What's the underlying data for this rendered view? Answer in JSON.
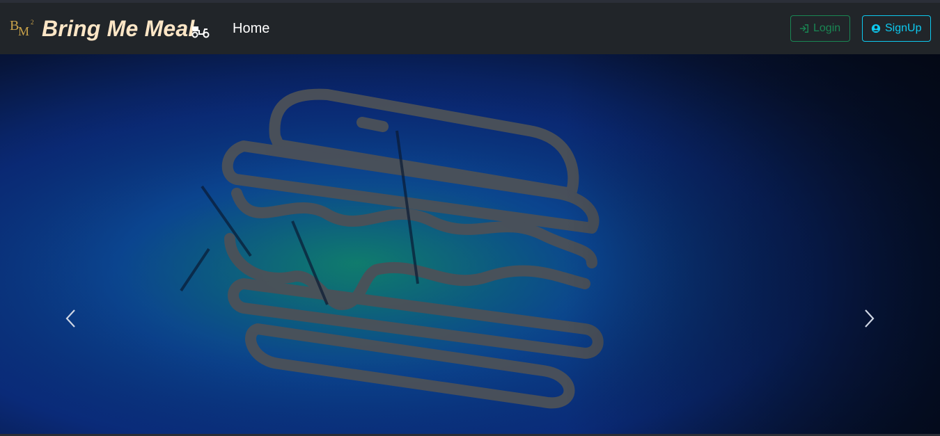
{
  "brand": {
    "name": "Bring Me Meal",
    "logo_icon": "bmm-monogram-logo",
    "scooter_icon": "delivery-scooter-icon",
    "color": "#fde6c6"
  },
  "nav": {
    "home_label": "Home"
  },
  "auth": {
    "login_label": "Login",
    "login_icon": "sign-in-icon",
    "login_color": "#198754",
    "signup_label": "SignUp",
    "signup_icon": "user-circle-icon",
    "signup_color": "#0dcaf0"
  },
  "carousel": {
    "slide_image": "neon-burger-sign",
    "prev_icon": "chevron-left-icon",
    "next_icon": "chevron-right-icon"
  },
  "colors": {
    "navbar_bg": "#212529",
    "page_bg": "#0b1020"
  }
}
